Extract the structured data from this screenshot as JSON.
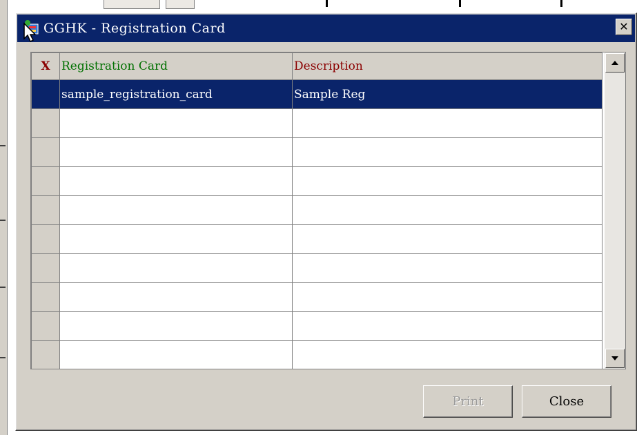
{
  "dialog": {
    "title": "GGHK - Registration Card",
    "close_glyph": "✕"
  },
  "grid": {
    "columns": {
      "x": "X",
      "card": "Registration Card",
      "desc": "Description"
    },
    "rows": [
      {
        "card": "sample_registration_card",
        "desc": "Sample Reg",
        "selected": true
      },
      {
        "card": "",
        "desc": ""
      },
      {
        "card": "",
        "desc": ""
      },
      {
        "card": "",
        "desc": ""
      },
      {
        "card": "",
        "desc": ""
      },
      {
        "card": "",
        "desc": ""
      },
      {
        "card": "",
        "desc": ""
      },
      {
        "card": "",
        "desc": ""
      },
      {
        "card": "",
        "desc": ""
      },
      {
        "card": "",
        "desc": ""
      }
    ]
  },
  "buttons": {
    "print_label": "Print",
    "close_label": "Close"
  },
  "icons": {
    "app": "app-icon",
    "cursor": "mouse-pointer-icon",
    "scroll_up": "scroll-up-arrow-icon",
    "scroll_down": "scroll-down-arrow-icon"
  },
  "colors": {
    "title_bg": "#0a246a",
    "selection_bg": "#0a246a",
    "header_card": "#007000",
    "header_desc": "#8b0000"
  }
}
